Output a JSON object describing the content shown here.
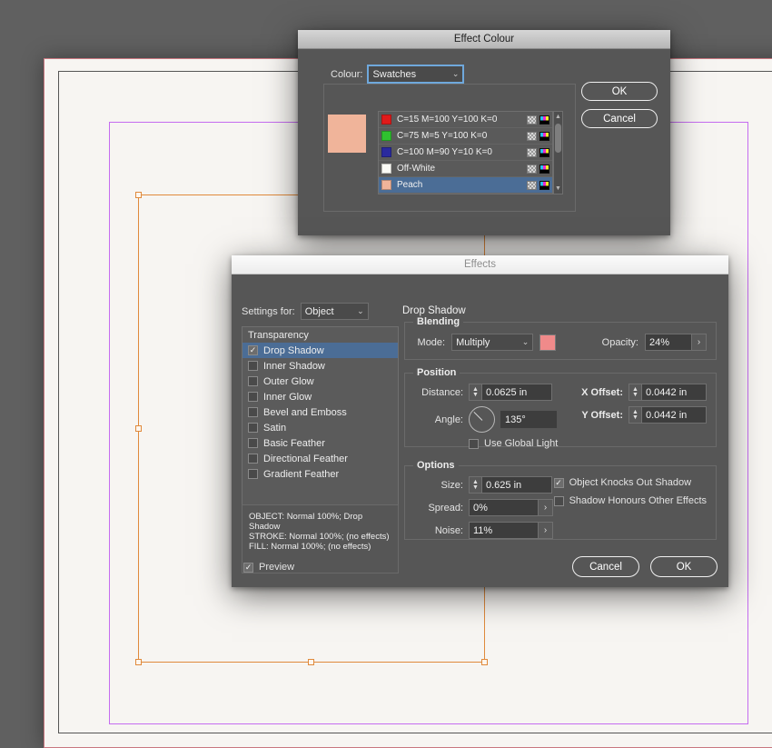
{
  "document_canvas": {
    "name": "indesign-document-canvas",
    "background_color": "#606060",
    "page_color": "#f7f5f2",
    "bleed_guide_color": "#c8767f",
    "margin_guide_color": "#c56cf0",
    "selection_color": "#e08a3c"
  },
  "effect_colour_dialog": {
    "title": "Effect Colour",
    "colour_label": "Colour:",
    "colour_mode": "Swatches",
    "preview_color": "#f0b49a",
    "ok_label": "OK",
    "cancel_label": "Cancel",
    "swatches": [
      {
        "name": "C=15 M=100 Y=100 K=0",
        "color": "#e01b1b",
        "selected": false
      },
      {
        "name": "C=75 M=5 Y=100 K=0",
        "color": "#2fc12f",
        "selected": false
      },
      {
        "name": "C=100 M=90 Y=10 K=0",
        "color": "#2a2a9e",
        "selected": false
      },
      {
        "name": "Off-White",
        "color": "#fbfbf6",
        "selected": false
      },
      {
        "name": "Peach",
        "color": "#f0b49a",
        "selected": true
      }
    ],
    "scroll_up_glyph": "▲",
    "scroll_down_glyph": "▼"
  },
  "effects_dialog": {
    "title": "Effects",
    "settings_for_label": "Settings for:",
    "settings_for_value": "Object",
    "transparency_header": "Transparency",
    "effects_list": [
      {
        "label": "Drop Shadow",
        "checked": true,
        "selected": true
      },
      {
        "label": "Inner Shadow",
        "checked": false,
        "selected": false
      },
      {
        "label": "Outer Glow",
        "checked": false,
        "selected": false
      },
      {
        "label": "Inner Glow",
        "checked": false,
        "selected": false
      },
      {
        "label": "Bevel and Emboss",
        "checked": false,
        "selected": false
      },
      {
        "label": "Satin",
        "checked": false,
        "selected": false
      },
      {
        "label": "Basic Feather",
        "checked": false,
        "selected": false
      },
      {
        "label": "Directional Feather",
        "checked": false,
        "selected": false
      },
      {
        "label": "Gradient Feather",
        "checked": false,
        "selected": false
      }
    ],
    "info_text": "OBJECT: Normal 100%; Drop Shadow\nSTROKE: Normal 100%; (no effects)\nFILL: Normal 100%; (no effects)",
    "panel_title": "Drop Shadow",
    "blending": {
      "group_title": "Blending",
      "mode_label": "Mode:",
      "mode_value": "Multiply",
      "swatch_color": "#f08a8a",
      "opacity_label": "Opacity:",
      "opacity_value": "24%"
    },
    "position": {
      "group_title": "Position",
      "distance_label": "Distance:",
      "distance_value": "0.0625 in",
      "angle_label": "Angle:",
      "angle_value": "135°",
      "use_global_light_label": "Use Global Light",
      "use_global_light_checked": false,
      "x_offset_label": "X Offset:",
      "x_offset_value": "0.0442 in",
      "y_offset_label": "Y Offset:",
      "y_offset_value": "0.0442 in"
    },
    "options": {
      "group_title": "Options",
      "size_label": "Size:",
      "size_value": "0.625 in",
      "spread_label": "Spread:",
      "spread_value": "0%",
      "noise_label": "Noise:",
      "noise_value": "11%",
      "knocks_out_label": "Object Knocks Out Shadow",
      "knocks_out_checked": true,
      "honours_label": "Shadow Honours Other Effects",
      "honours_checked": false
    },
    "preview_label": "Preview",
    "preview_checked": true,
    "cancel_label": "Cancel",
    "ok_label": "OK"
  },
  "glyphs": {
    "chevron_down": "⌄",
    "check": "✓",
    "stepper_up": "▲",
    "stepper_down": "▼",
    "arrow_right": "›"
  }
}
